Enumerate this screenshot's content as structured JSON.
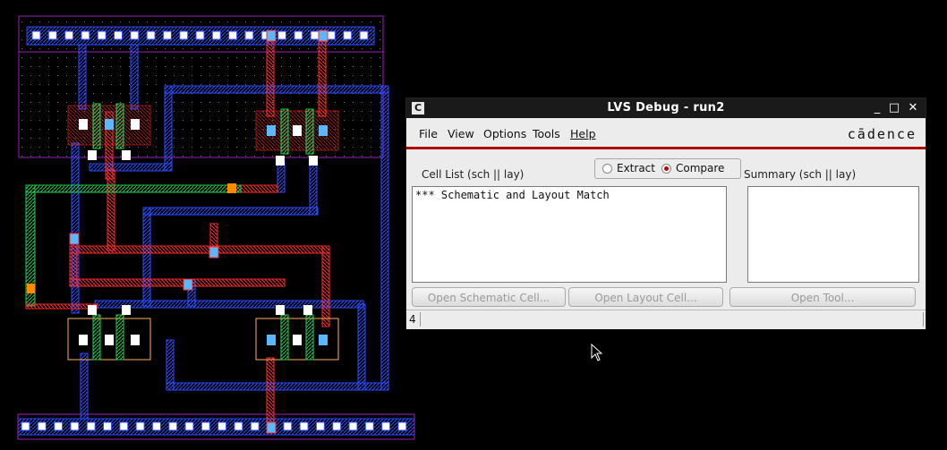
{
  "layout_view": {
    "colors": {
      "background": "#000000",
      "metal1": "#2a4cff",
      "poly": "#ff2a2a",
      "contact": "#5ab8ff",
      "nwell": "#a020c0",
      "green": "#22cc55",
      "orange": "#ff8a00",
      "pselect": "#ffb060",
      "white": "#ffffff"
    }
  },
  "lvs_window": {
    "title": "LVS Debug - run2",
    "app_icon_letter": "C",
    "window_controls": {
      "minimize": "_",
      "maximize": "□",
      "close": "✕"
    },
    "menu": {
      "file": "File",
      "view": "View",
      "options": "Options",
      "tools": "Tools",
      "help": "Help"
    },
    "brand": "cādence",
    "mode": {
      "options": [
        "Extract",
        "Compare"
      ],
      "selected": "Compare",
      "extract_label": "Extract",
      "compare_label": "Compare"
    },
    "cell_list_label": "Cell List (sch || lay)",
    "summary_label": "Summary (sch || lay)",
    "cell_list_items": [
      "*** Schematic and Layout Match"
    ],
    "buttons": {
      "open_schematic": "Open Schematic Cell...",
      "open_layout": "Open Layout Cell...",
      "open_tool": "Open Tool..."
    },
    "status_number": "4"
  }
}
